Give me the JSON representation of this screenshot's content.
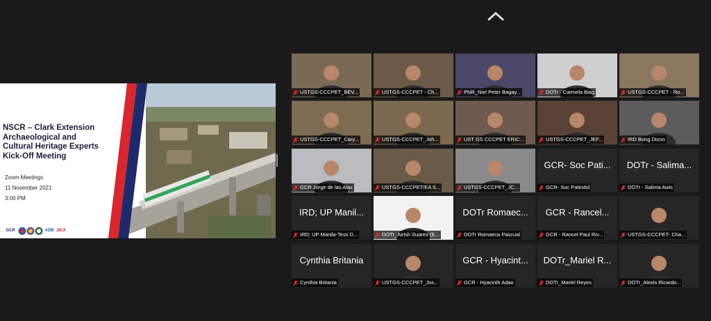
{
  "chrome": {
    "collapse_icon": "chevron-up-icon"
  },
  "slide": {
    "title_lines": [
      "NSCR – Clark Extension",
      "Archaeological and",
      "Cultural Heritage Experts",
      "Kick-Off Meeting"
    ],
    "subtitle": "Zoom Meetings",
    "date": "11 November 2021",
    "time": "3:00 PM",
    "logos": [
      "GCR",
      "ADB",
      "JICA"
    ],
    "colors": {
      "red_band": "#d8262f",
      "navy_band": "#1f2a6b"
    }
  },
  "participants": [
    {
      "label": "USTGS-CCCPET_BEV...",
      "big": "",
      "kind": "video",
      "bg": "#7a6a55"
    },
    {
      "label": "USTGS-CCCPET - Ch...",
      "big": "",
      "kind": "video",
      "bg": "#6b5a48"
    },
    {
      "label": "PNR_Niel Peter Bagay...",
      "big": "",
      "kind": "video",
      "bg": "#4a4866"
    },
    {
      "label": "DOTr - Carmela Biag",
      "big": "",
      "kind": "video",
      "bg": "#cfcfcf"
    },
    {
      "label": "USTGS-CCCPET - Ro...",
      "big": "",
      "kind": "video",
      "bg": "#8a7760"
    },
    {
      "label": "USTGS-CCCPET_Cary...",
      "big": "",
      "kind": "video",
      "bg": "#7d6b52"
    },
    {
      "label": "USTGS-CCCPET_Joh...",
      "big": "",
      "kind": "video",
      "bg": "#7b6a50"
    },
    {
      "label": "UST GS CCCPET ERIC...",
      "big": "",
      "kind": "video",
      "bg": "#6e5a4e"
    },
    {
      "label": "USTGS-CCCPET_JEF...",
      "big": "",
      "kind": "video",
      "bg": "#5a4336"
    },
    {
      "label": "IRD Bong Dizon",
      "big": "",
      "kind": "video",
      "bg": "#5c5c5c"
    },
    {
      "label": "GCR Jorge de las Alas",
      "big": "",
      "kind": "video",
      "bg": "#b9bcc0"
    },
    {
      "label": "USTGS-CCCPET/EA S...",
      "big": "",
      "kind": "video",
      "bg": "#6a5b48"
    },
    {
      "label": "USTGS-CCCPET_JC...",
      "big": "",
      "kind": "video",
      "bg": "#8a8a8a"
    },
    {
      "label": "GCR- Soc Patindol",
      "big": "GCR- Soc Pati...",
      "kind": "name",
      "bg": "#262626"
    },
    {
      "label": "DOTr - Salima Awis",
      "big": "DOTr - Salima...",
      "kind": "name",
      "bg": "#262626"
    },
    {
      "label": "IRD; UP Manila-Tess D...",
      "big": "IRD; UP Manil...",
      "kind": "name",
      "bg": "#262626"
    },
    {
      "label": "DOTr_Airish Suarez (E...",
      "big": "",
      "kind": "video",
      "bg": "#f2f2f2"
    },
    {
      "label": "DOTr Romaeca Pascual",
      "big": "DOTr Romaec...",
      "kind": "name",
      "bg": "#262626"
    },
    {
      "label": "GCR - Rancel Paul Riv...",
      "big": "GCR - Rancel...",
      "kind": "name",
      "bg": "#262626"
    },
    {
      "label": "USTGS-CCCPET- Cha...",
      "big": "",
      "kind": "video",
      "bg": "#262626"
    },
    {
      "label": "Cynthia Britania",
      "big": "Cynthia Britania",
      "kind": "name",
      "bg": "#262626"
    },
    {
      "label": "USTGS-CCCPET_Jos...",
      "big": "",
      "kind": "video",
      "bg": "#262626"
    },
    {
      "label": "GCR - Hyacinth Adao",
      "big": "GCR - Hyacint...",
      "kind": "name",
      "bg": "#262626"
    },
    {
      "label": "DOTr_Mariel Reyes",
      "big": "DOTr_Mariel R...",
      "kind": "name",
      "bg": "#262626"
    },
    {
      "label": "DOTr_Alexis Ricardo...",
      "big": "",
      "kind": "video",
      "bg": "#262626"
    }
  ],
  "icons": {
    "muted": "muted-mic-icon"
  },
  "colors": {
    "background": "#1a1a1a",
    "tile": "#262626",
    "muted_red": "#e0312a"
  }
}
